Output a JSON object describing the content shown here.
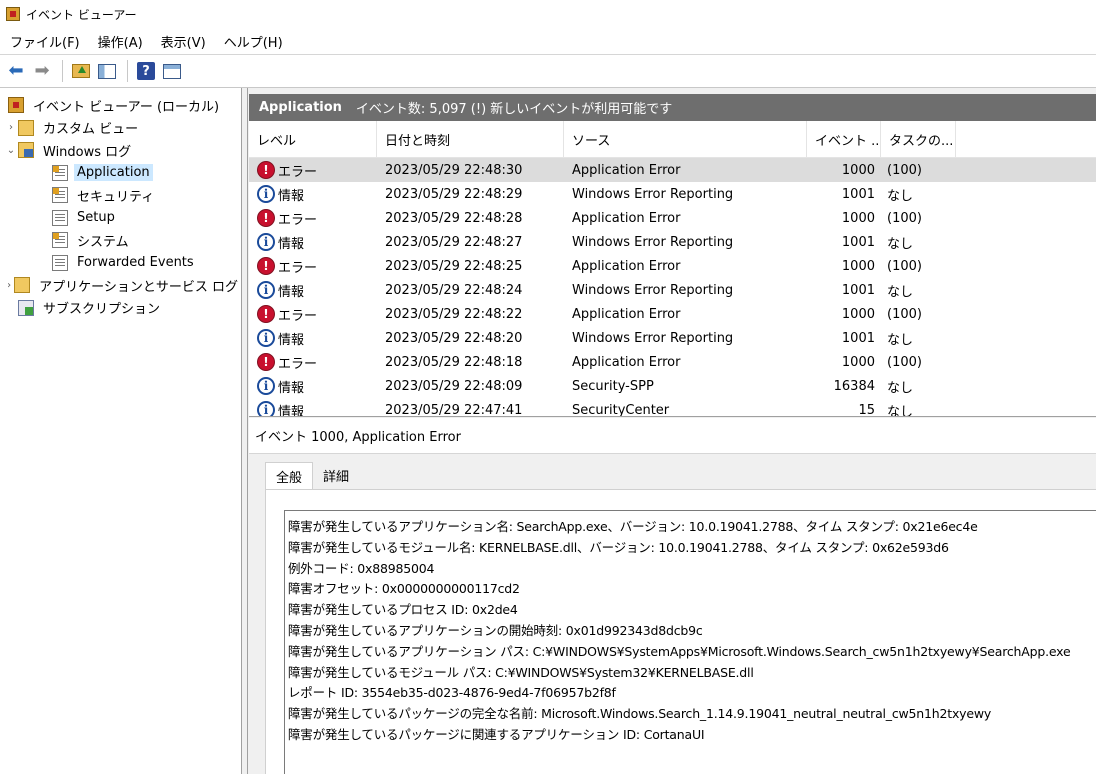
{
  "window": {
    "title": "イベント ビューアー",
    "app_icon": "event-viewer-icon"
  },
  "menu": [
    {
      "id": "file",
      "label": "ファイル(F)"
    },
    {
      "id": "action",
      "label": "操作(A)"
    },
    {
      "id": "view",
      "label": "表示(V)"
    },
    {
      "id": "help",
      "label": "ヘルプ(H)"
    }
  ],
  "toolbar": {
    "buttons": [
      "back-arrow-icon",
      "forward-arrow-icon",
      "folder-up-icon",
      "show-hide-tree-icon",
      "help-icon",
      "show-hide-action-pane-icon"
    ],
    "help_glyph": "?"
  },
  "tree": {
    "items": [
      {
        "label": "イベント ビューアー (ローカル)",
        "level": 0,
        "chevron": "",
        "icon": "event-viewer-root-icon"
      },
      {
        "label": "カスタム ビュー",
        "level": 0,
        "chevron": "›",
        "icon": "folder-icon"
      },
      {
        "label": "Windows ログ",
        "level": 0,
        "chevron": "⌄",
        "icon": "windows-logs-folder-icon"
      },
      {
        "label": "Application",
        "level": 1,
        "chevron": "",
        "icon": "log-warning-icon",
        "selected": true
      },
      {
        "label": "セキュリティ",
        "level": 1,
        "chevron": "",
        "icon": "log-warning-icon"
      },
      {
        "label": "Setup",
        "level": 1,
        "chevron": "",
        "icon": "log-icon"
      },
      {
        "label": "システム",
        "level": 1,
        "chevron": "",
        "icon": "log-warning-icon"
      },
      {
        "label": "Forwarded Events",
        "level": 1,
        "chevron": "",
        "icon": "log-icon"
      },
      {
        "label": "アプリケーションとサービス ログ",
        "level": 0,
        "chevron": "›",
        "icon": "folder-icon"
      },
      {
        "label": "サブスクリプション",
        "level": 0,
        "chevron": "",
        "icon": "subscriptions-icon"
      }
    ]
  },
  "list": {
    "log_name": "Application",
    "summary": "イベント数: 5,097 (!) 新しいイベントが利用可能です",
    "columns": {
      "level": "レベル",
      "date": "日付と時刻",
      "source": "ソース",
      "event_id": "イベント ...",
      "task": "タスクの..."
    },
    "rows": [
      {
        "type": "error",
        "level": "エラー",
        "date": "2023/05/29 22:48:30",
        "source": "Application Error",
        "event_id": "1000",
        "task": "(100)",
        "selected": true
      },
      {
        "type": "info",
        "level": "情報",
        "date": "2023/05/29 22:48:29",
        "source": "Windows Error Reporting",
        "event_id": "1001",
        "task": "なし"
      },
      {
        "type": "error",
        "level": "エラー",
        "date": "2023/05/29 22:48:28",
        "source": "Application Error",
        "event_id": "1000",
        "task": "(100)"
      },
      {
        "type": "info",
        "level": "情報",
        "date": "2023/05/29 22:48:27",
        "source": "Windows Error Reporting",
        "event_id": "1001",
        "task": "なし"
      },
      {
        "type": "error",
        "level": "エラー",
        "date": "2023/05/29 22:48:25",
        "source": "Application Error",
        "event_id": "1000",
        "task": "(100)"
      },
      {
        "type": "info",
        "level": "情報",
        "date": "2023/05/29 22:48:24",
        "source": "Windows Error Reporting",
        "event_id": "1001",
        "task": "なし"
      },
      {
        "type": "error",
        "level": "エラー",
        "date": "2023/05/29 22:48:22",
        "source": "Application Error",
        "event_id": "1000",
        "task": "(100)"
      },
      {
        "type": "info",
        "level": "情報",
        "date": "2023/05/29 22:48:20",
        "source": "Windows Error Reporting",
        "event_id": "1001",
        "task": "なし"
      },
      {
        "type": "error",
        "level": "エラー",
        "date": "2023/05/29 22:48:18",
        "source": "Application Error",
        "event_id": "1000",
        "task": "(100)"
      },
      {
        "type": "info",
        "level": "情報",
        "date": "2023/05/29 22:48:09",
        "source": "Security-SPP",
        "event_id": "16384",
        "task": "なし"
      },
      {
        "type": "info",
        "level": "情報",
        "date": "2023/05/29 22:47:41",
        "source": "SecurityCenter",
        "event_id": "15",
        "task": "なし"
      }
    ]
  },
  "detail": {
    "title": "イベント 1000, Application Error",
    "tabs": [
      {
        "label": "全般",
        "active": true
      },
      {
        "label": "詳細",
        "active": false
      }
    ],
    "message_lines": [
      "障害が発生しているアプリケーション名: SearchApp.exe、バージョン: 10.0.19041.2788、タイム スタンプ: 0x21e6ec4e",
      "障害が発生しているモジュール名: KERNELBASE.dll、バージョン: 10.0.19041.2788、タイム スタンプ: 0x62e593d6",
      "例外コード: 0x88985004",
      "障害オフセット: 0x0000000000117cd2",
      "障害が発生しているプロセス ID: 0x2de4",
      "障害が発生しているアプリケーションの開始時刻: 0x01d992343d8dcb9c",
      "障害が発生しているアプリケーション パス: C:¥WINDOWS¥SystemApps¥Microsoft.Windows.Search_cw5n1h2txyewy¥SearchApp.exe",
      "障害が発生しているモジュール パス: C:¥WINDOWS¥System32¥KERNELBASE.dll",
      "レポート ID: 3554eb35-d023-4876-9ed4-7f06957b2f8f",
      "障害が発生しているパッケージの完全な名前: Microsoft.Windows.Search_1.14.9.19041_neutral_neutral_cw5n1h2txyewy",
      "障害が発生しているパッケージに関連するアプリケーション ID: CortanaUI"
    ]
  }
}
